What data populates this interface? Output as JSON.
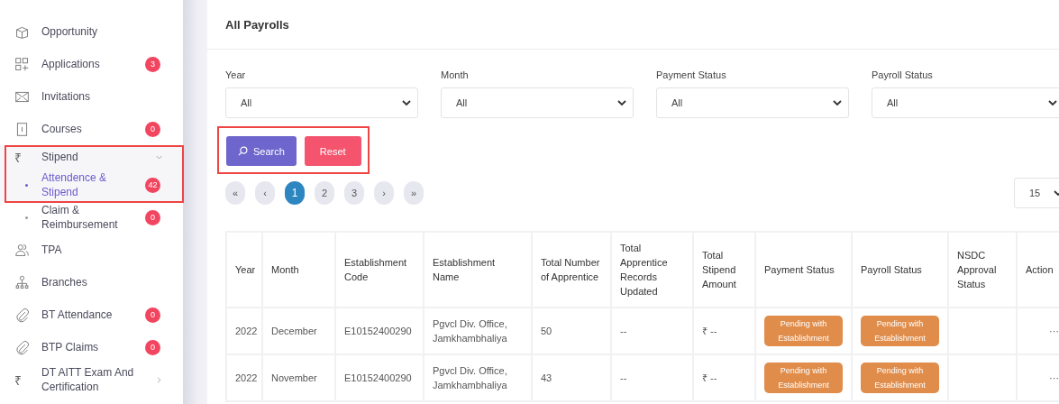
{
  "sidebar": {
    "items": [
      {
        "label": "Opportunity",
        "kind": "box"
      },
      {
        "label": "Applications",
        "kind": "grid",
        "badge": "3"
      },
      {
        "label": "Invitations",
        "kind": "mail"
      },
      {
        "label": "Courses",
        "kind": "book",
        "badge": "0"
      },
      {
        "label": "Stipend",
        "symbol": "₹",
        "expanded": true,
        "highlighted": true,
        "children": [
          {
            "label": "Attendence & Stipend",
            "badge": "42",
            "selected": true
          },
          {
            "label": "Claim & Reimbursement",
            "badge": "0",
            "selected": false
          }
        ]
      },
      {
        "label": "TPA",
        "kind": "people"
      },
      {
        "label": "Branches",
        "kind": "tree"
      },
      {
        "label": "BT Attendance",
        "kind": "clip",
        "badge": "0"
      },
      {
        "label": "BTP Claims",
        "kind": "clip",
        "badge": "0"
      },
      {
        "label": "DT AITT Exam And Certification",
        "symbol": "₹",
        "expanded": false
      }
    ]
  },
  "page_title": "All Payrolls",
  "filters": [
    {
      "label": "Year",
      "value": "All"
    },
    {
      "label": "Month",
      "value": "All"
    },
    {
      "label": "Payment Status",
      "value": "All"
    },
    {
      "label": "Payroll Status",
      "value": "All"
    }
  ],
  "actions": {
    "highlighted": true,
    "buttons": [
      {
        "label": "Search",
        "kind": "primary"
      },
      {
        "label": "Reset",
        "kind": "danger"
      }
    ]
  },
  "pagination": [
    {
      "label": "«",
      "selected": false
    },
    {
      "label": "‹",
      "selected": false
    },
    {
      "label": "1",
      "selected": true
    },
    {
      "label": "2",
      "selected": false
    },
    {
      "label": "3",
      "selected": false
    },
    {
      "label": "›",
      "selected": false
    },
    {
      "label": "»",
      "selected": false
    }
  ],
  "page_size": "15",
  "table": {
    "columns": [
      "Year",
      "Month",
      "Establishment Code",
      "Establishment Name",
      "Total Number of Apprentice",
      "Total Apprentice Records Updated",
      "Total Stipend Amount",
      "Payment Status",
      "Payroll Status",
      "NSDC Approval Status",
      "Action"
    ],
    "rows": [
      {
        "year": "2022",
        "month": "December",
        "establishment_code": "E10152400290",
        "establishment_name": "Pgvcl Div. Office, Jamkhambhaliya",
        "total_apprentices": "50",
        "records_updated": "--",
        "stipend_amount": "₹ --",
        "payment_status": "Pending with Establishment",
        "payroll_status": "Pending with Establishment",
        "action": "···"
      },
      {
        "year": "2022",
        "month": "November",
        "establishment_code": "E10152400290",
        "establishment_name": "Pgvcl Div. Office, Jamkhambhaliya",
        "total_apprentices": "43",
        "records_updated": "--",
        "stipend_amount": "₹ --",
        "payment_status": "Pending with Establishment",
        "payroll_status": "Pending with Establishment",
        "action": "···"
      }
    ]
  }
}
